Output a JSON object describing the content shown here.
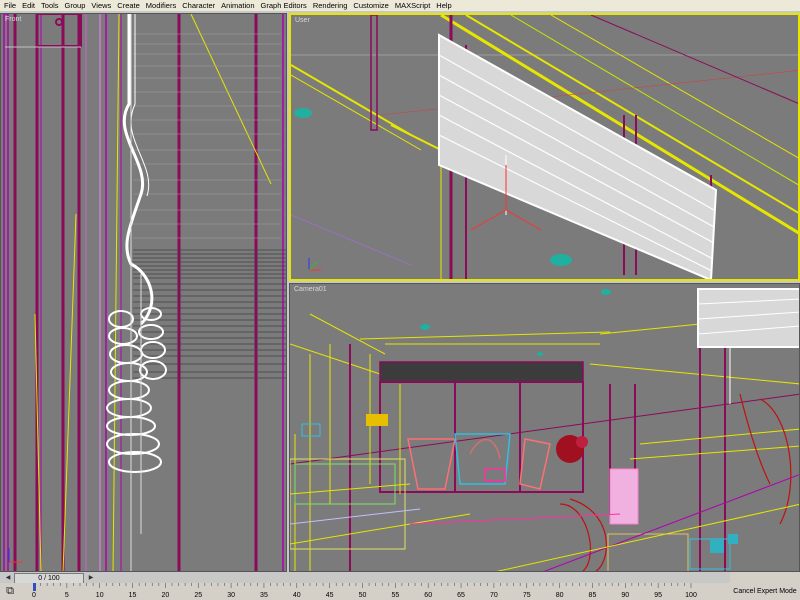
{
  "menu": [
    "File",
    "Edit",
    "Tools",
    "Group",
    "Views",
    "Create",
    "Modifiers",
    "Character",
    "Animation",
    "Graph Editors",
    "Rendering",
    "Customize",
    "MAXScript",
    "Help"
  ],
  "viewports": {
    "front": {
      "label": "Front"
    },
    "user": {
      "label": "User"
    },
    "camera": {
      "label": "Camera01"
    }
  },
  "timeline": {
    "slider_label": "0 / 100",
    "prev_icon": "arrow-left-icon",
    "next_icon": "arrow-right-icon",
    "ticks": [
      0,
      5,
      10,
      15,
      20,
      25,
      30,
      35,
      40,
      45,
      50,
      55,
      60,
      65,
      70,
      75,
      80,
      85,
      90,
      95,
      100
    ]
  },
  "status": {
    "cancel_expert_label": "Cancel Expert Mode"
  },
  "colors": {
    "viewport_bg": "#7b7b7b",
    "active_border": "#e6e600",
    "ui_bg": "#d4d0c8"
  }
}
